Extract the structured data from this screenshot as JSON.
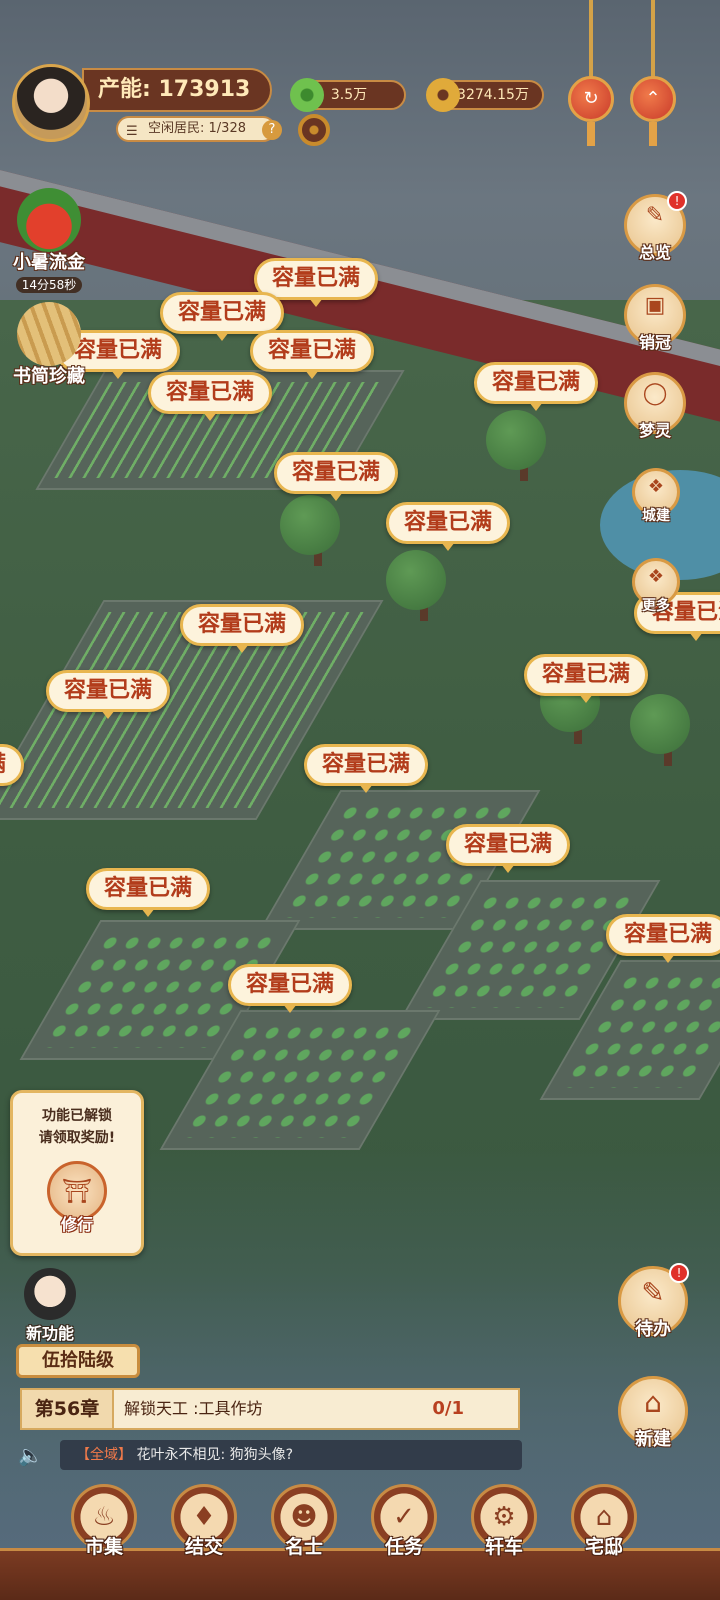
{
  "player": {
    "capacity_label": "产能:",
    "capacity_value": "173913",
    "idle_residents_label": "空闲居民:",
    "idle_residents_value": "1/328",
    "help": "?"
  },
  "currencies": [
    {
      "icon": "jade-coin-icon",
      "value": "3.5万"
    },
    {
      "icon": "copper-coin-icon",
      "value": "3274.15万"
    }
  ],
  "events": [
    {
      "label": "小暑流金",
      "timer": "14分58秒",
      "icon": "watermelon-icon"
    },
    {
      "label": "书简珍藏",
      "icon": "bamboo-scroll-icon"
    }
  ],
  "right_menu": [
    {
      "label": "总览",
      "icon": "overview-icon",
      "badge": "!"
    },
    {
      "label": "销冠",
      "icon": "sales-crown-icon"
    },
    {
      "label": "梦灵",
      "icon": "spirit-pig-icon"
    },
    {
      "label": "城建",
      "icon": "city-build-icon"
    },
    {
      "label": "更多",
      "icon": "more-icon"
    }
  ],
  "bubble_text": "容量已满",
  "unlock": {
    "line1": "功能已解锁",
    "line2": "请领取奖励!",
    "feature_label": "修行"
  },
  "new_feature_label": "新功能",
  "level_tag": "伍拾陆级",
  "chapter": {
    "number": "第56章",
    "task": "解锁天工 :工具作坊",
    "progress": "0/1"
  },
  "chat": {
    "channel": "【全域】",
    "message": "花叶永不相见: 狗狗头像?"
  },
  "side_actions": [
    {
      "label": "待办",
      "icon": "todo-icon",
      "badge": "!"
    },
    {
      "label": "新建",
      "icon": "new-build-icon"
    }
  ],
  "bottom_nav": [
    {
      "label": "市集",
      "icon": "market-icon"
    },
    {
      "label": "结交",
      "icon": "friends-icon"
    },
    {
      "label": "名士",
      "icon": "celebrity-icon"
    },
    {
      "label": "任务",
      "icon": "task-icon"
    },
    {
      "label": "轩车",
      "icon": "carriage-icon"
    },
    {
      "label": "宅邸",
      "icon": "mansion-icon"
    }
  ],
  "colors": {
    "bubble_text": "#b23c1b",
    "bubble_border": "#e8b64f",
    "panel_brown": "#6a3522",
    "accent_gold": "#c88b44"
  }
}
